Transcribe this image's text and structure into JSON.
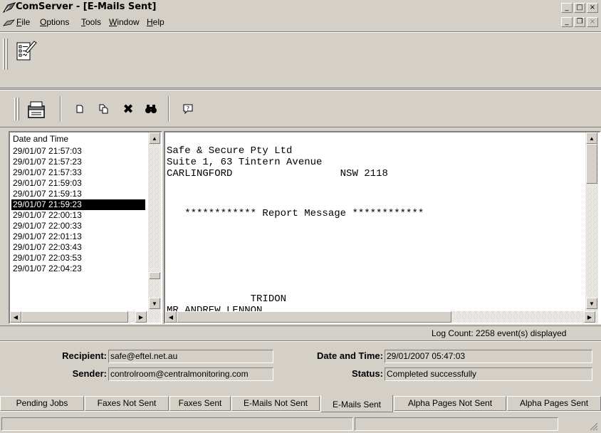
{
  "window": {
    "title": "ComServer - [E-Mails Sent]"
  },
  "menu": [
    {
      "label": "File",
      "accel": "F",
      "rest": "ile"
    },
    {
      "label": "Options",
      "accel": "O",
      "rest": "ptions"
    },
    {
      "label": "Tools",
      "accel": "T",
      "rest": "ools"
    },
    {
      "label": "Window",
      "accel": "W",
      "rest": "indow"
    },
    {
      "label": "Help",
      "accel": "H",
      "rest": "elp"
    }
  ],
  "list": {
    "header": "Date and Time",
    "items": [
      "29/01/07 21:57:03",
      "29/01/07 21:57:23",
      "29/01/07 21:57:33",
      "29/01/07 21:59:03",
      "29/01/07 21:59:13",
      "29/01/07 21:59:23",
      "29/01/07 22:00:13",
      "29/01/07 22:00:33",
      "29/01/07 22:01:13",
      "29/01/07 22:03:43",
      "29/01/07 22:03:53",
      "29/01/07 22:04:23"
    ],
    "selected_index": 5
  },
  "message": {
    "lines": [
      "Safe & Secure Pty Ltd",
      "Suite 1, 63 Tintern Avenue",
      "CARLINGFORD                  NSW 2118",
      "",
      "   ************ Report Message ************",
      "",
      "",
      "",
      "",
      "",
      "              TRIDON"
    ],
    "partial_line": "MR ANDREW LENNON"
  },
  "log_count": "Log Count:  2258 event(s) displayed",
  "details": {
    "recipient_label": "Recipient:",
    "recipient": "safe@eftel.net.au",
    "sender_label": "Sender:",
    "sender": "controlroom@centralmonitoring.com",
    "datetime_label": "Date and Time:",
    "datetime": "29/01/2007 05:47:03",
    "status_label": "Status:",
    "status": "Completed successfully"
  },
  "tabs": [
    "Pending Jobs",
    "Faxes Not Sent",
    "Faxes Sent",
    "E-Mails Not Sent",
    "E-Mails Sent",
    "Alpha Pages Not Sent",
    "Alpha Pages Sent"
  ],
  "active_tab": 4,
  "icons": {
    "title": "comserver-logo-icon",
    "tool1": "report-form-icon",
    "toolbar": [
      "cabinet-icon",
      "new-document-icon",
      "copy-icon",
      "delete-icon",
      "find-icon",
      "help-icon"
    ]
  }
}
